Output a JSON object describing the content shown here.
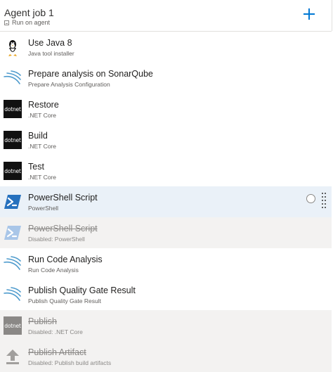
{
  "job": {
    "title": "Agent job 1",
    "subtitle": "Run on agent",
    "add_icon": "plus-icon",
    "accent": "#0078d4"
  },
  "tasks": [
    {
      "name": "Use Java 8",
      "desc": "Java tool installer",
      "icon": "java-icon",
      "state": "normal"
    },
    {
      "name": "Prepare analysis on SonarQube",
      "desc": "Prepare Analysis Configuration",
      "icon": "sonarqube-icon",
      "state": "normal"
    },
    {
      "name": "Restore",
      "desc": ".NET Core",
      "icon": "dotnet-icon",
      "state": "normal",
      "icon_text": "dotnet"
    },
    {
      "name": "Build",
      "desc": ".NET Core",
      "icon": "dotnet-icon",
      "state": "normal",
      "icon_text": "dotnet"
    },
    {
      "name": "Test",
      "desc": ".NET Core",
      "icon": "dotnet-icon",
      "state": "normal",
      "icon_text": "dotnet"
    },
    {
      "name": "PowerShell Script",
      "desc": "PowerShell",
      "icon": "powershell-icon",
      "state": "selected"
    },
    {
      "name": "PowerShell Script",
      "desc": "Disabled: PowerShell",
      "icon": "powershell-icon",
      "state": "disabled"
    },
    {
      "name": "Run Code Analysis",
      "desc": "Run Code Analysis",
      "icon": "sonarqube-icon",
      "state": "normal"
    },
    {
      "name": "Publish Quality Gate Result",
      "desc": "Publish Quality Gate Result",
      "icon": "sonarqube-icon",
      "state": "normal"
    },
    {
      "name": "Publish",
      "desc": "Disabled: .NET Core",
      "icon": "dotnet-icon",
      "state": "disabled",
      "icon_text": "dotnet"
    },
    {
      "name": "Publish Artifact",
      "desc": "Disabled: Publish build artifacts",
      "icon": "upload-icon",
      "state": "disabled"
    }
  ]
}
